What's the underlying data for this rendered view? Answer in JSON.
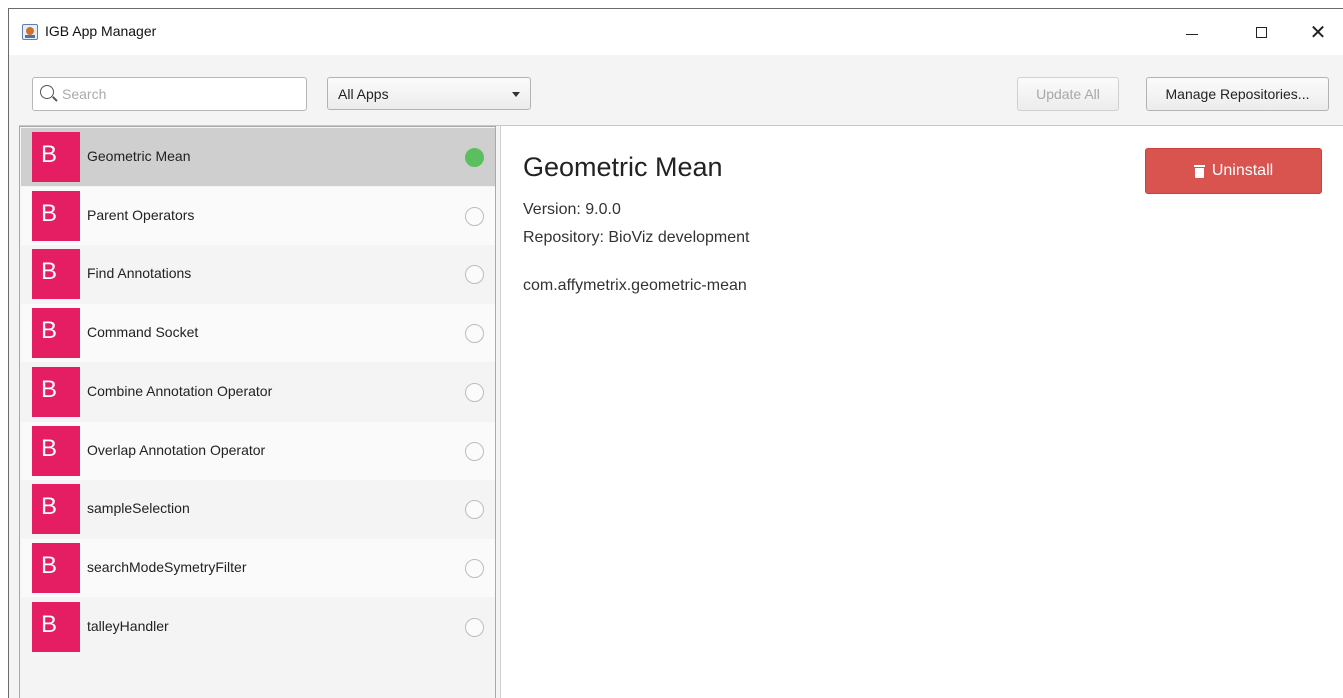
{
  "window": {
    "title": "IGB App Manager"
  },
  "toolbar": {
    "search_placeholder": "Search",
    "filter_selected": "All Apps",
    "update_all_label": "Update All",
    "manage_repositories_label": "Manage Repositories..."
  },
  "apps": [
    {
      "icon_letter": "B",
      "name": "Geometric Mean",
      "installed": true
    },
    {
      "icon_letter": "B",
      "name": "Parent Operators",
      "installed": false
    },
    {
      "icon_letter": "B",
      "name": "Find Annotations",
      "installed": false
    },
    {
      "icon_letter": "B",
      "name": "Command Socket",
      "installed": false
    },
    {
      "icon_letter": "B",
      "name": "Combine Annotation Operator",
      "installed": false
    },
    {
      "icon_letter": "B",
      "name": "Overlap Annotation Operator",
      "installed": false
    },
    {
      "icon_letter": "B",
      "name": "sampleSelection",
      "installed": false
    },
    {
      "icon_letter": "B",
      "name": "searchModeSymetryFilter",
      "installed": false
    },
    {
      "icon_letter": "B",
      "name": "talleyHandler",
      "installed": false
    }
  ],
  "details": {
    "title": "Geometric Mean",
    "version": "Version: 9.0.0",
    "repository": "Repository: BioViz development",
    "identifier": "com.affymetrix.geometric-mean",
    "uninstall_label": "Uninstall"
  },
  "colors": {
    "app_icon": "#e51e63",
    "uninstall_button": "#d9534f",
    "installed_status": "#5cbf5f",
    "selected_row": "#cfcfcf"
  }
}
